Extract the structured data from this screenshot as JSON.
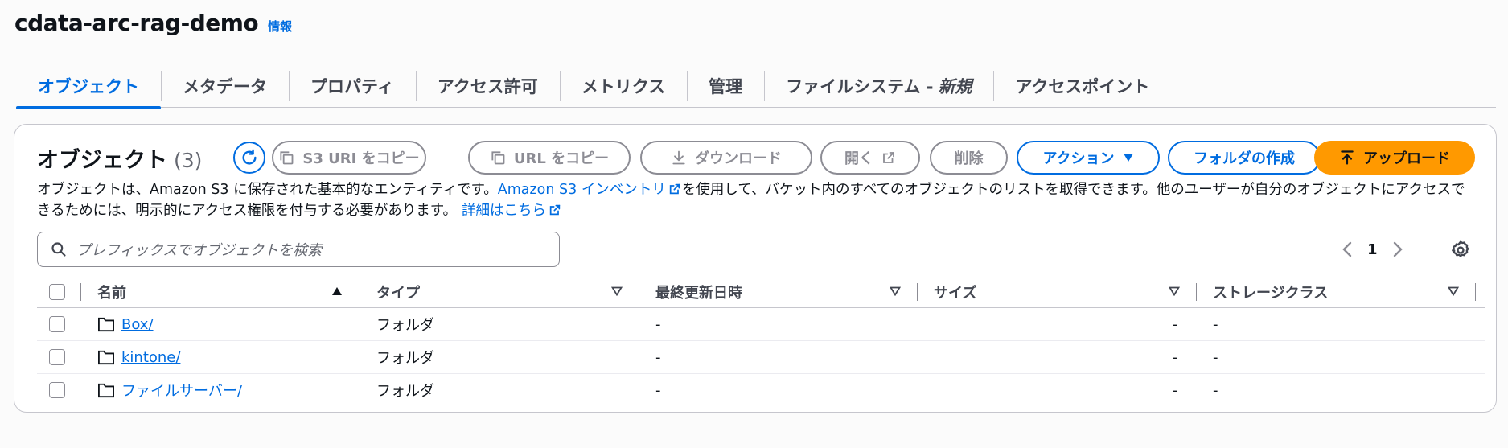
{
  "header": {
    "title": "cdata-arc-rag-demo",
    "info": "情報"
  },
  "tabs": [
    {
      "label": "オブジェクト",
      "active": true
    },
    {
      "label": "メタデータ"
    },
    {
      "label": "プロパティ"
    },
    {
      "label": "アクセス許可"
    },
    {
      "label": "メトリクス"
    },
    {
      "label": "管理"
    },
    {
      "label": "ファイルシステム -",
      "suffix": "新規"
    },
    {
      "label": "アクセスポイント"
    }
  ],
  "panel": {
    "title": "オブジェクト",
    "count": "(3)",
    "buttons": {
      "copy_s3_uri": "S3 URI をコピー",
      "copy_url": "URL をコピー",
      "download": "ダウンロード",
      "open": "開く",
      "delete": "削除",
      "actions": "アクション",
      "create_folder": "フォルダの作成",
      "upload": "アップロード"
    },
    "description": {
      "part1": "オブジェクトは、Amazon S3 に保存された基本的なエンティティです。",
      "link1": "Amazon S3 インベントリ",
      "part2": "を使用して、バケット内のすべてのオブジェクトのリストを取得できます。他のユーザーが自分のオブジェクトにアクセスできるためには、明示的にアクセス権限を付与する必要があります。",
      "link2": "詳細はこちら"
    },
    "search": {
      "placeholder": "プレフィックスでオブジェクトを検索"
    },
    "pagination": {
      "page": "1"
    }
  },
  "table": {
    "columns": {
      "name": "名前",
      "type": "タイプ",
      "modified": "最終更新日時",
      "size": "サイズ",
      "storage": "ストレージクラス"
    },
    "rows": [
      {
        "name": "Box/",
        "type": "フォルダ",
        "modified": "-",
        "size": "-",
        "storage": "-"
      },
      {
        "name": "kintone/",
        "type": "フォルダ",
        "modified": "-",
        "size": "-",
        "storage": "-"
      },
      {
        "name": "ファイルサーバー/",
        "type": "フォルダ",
        "modified": "-",
        "size": "-",
        "storage": "-"
      }
    ]
  },
  "colors": {
    "accent": "#006ce0",
    "upload": "#ff9900"
  }
}
